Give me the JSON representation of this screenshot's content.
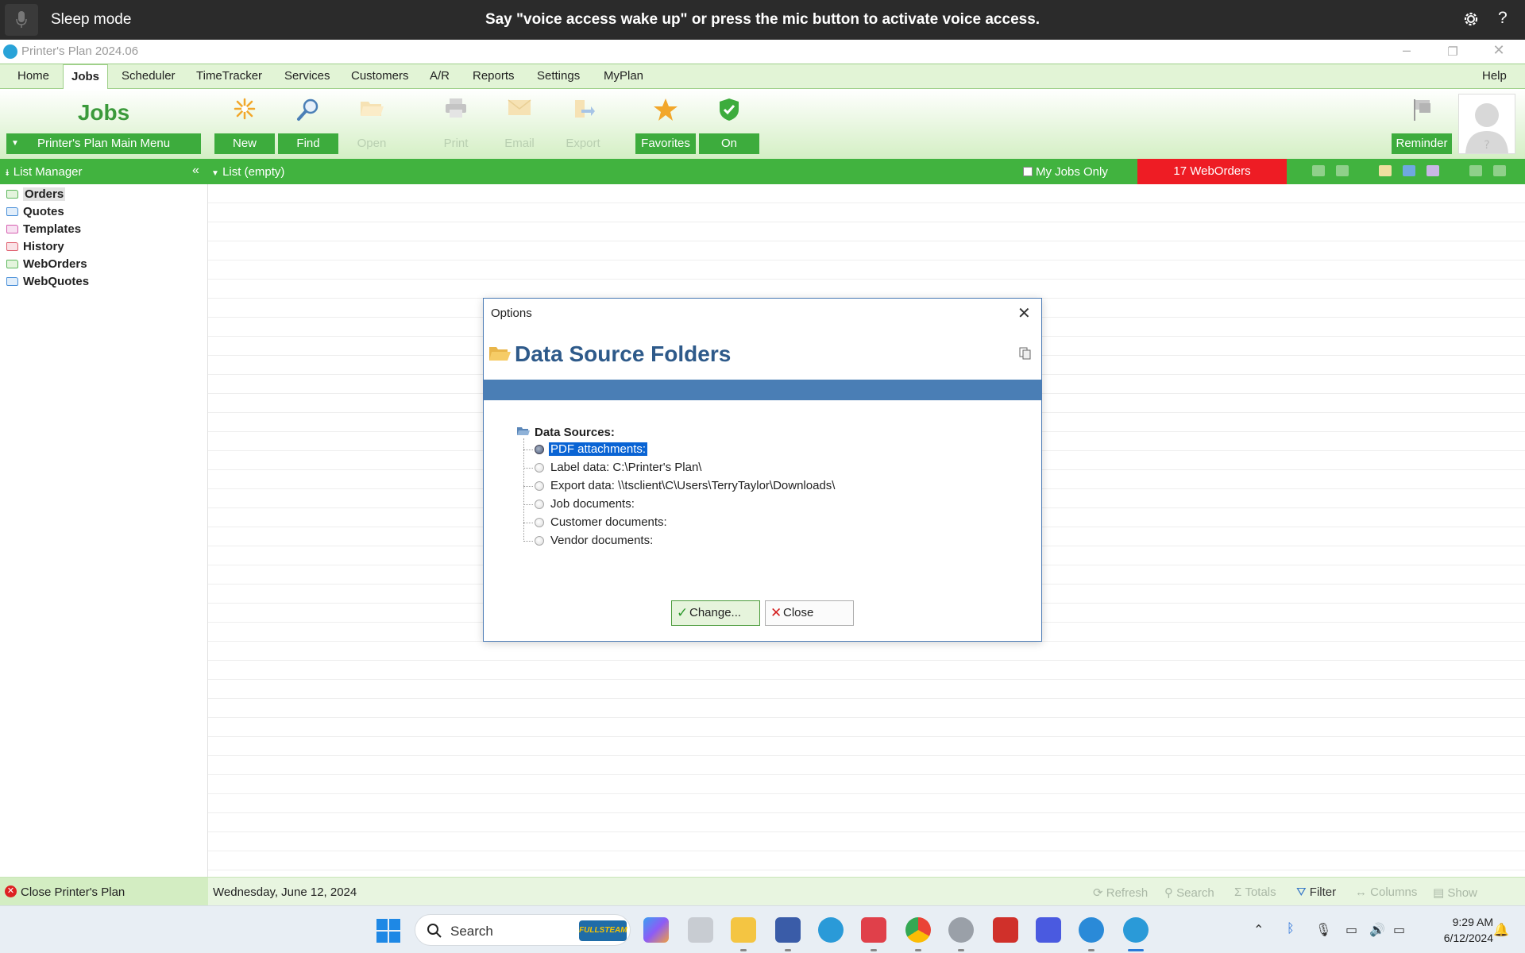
{
  "voice_bar": {
    "status": "Sleep mode",
    "message": "Say \"voice access wake up\" or press the mic button to activate voice access.",
    "help_label": "?"
  },
  "window": {
    "title": "Printer's Plan 2024.06"
  },
  "menu": {
    "tabs": [
      "Home",
      "Jobs",
      "Scheduler",
      "TimeTracker",
      "Services",
      "Customers",
      "A/R",
      "Reports",
      "Settings",
      "MyPlan"
    ],
    "active": "Jobs",
    "help": "Help"
  },
  "ribbon": {
    "section_title": "Jobs",
    "main_menu_label": "Printer's Plan Main Menu",
    "buttons": {
      "new": "New",
      "find": "Find",
      "open": "Open",
      "print": "Print",
      "email": "Email",
      "export": "Export",
      "favorites": "Favorites",
      "on": "On",
      "reminder": "Reminder"
    }
  },
  "list_bar": {
    "list_manager": "List Manager",
    "collapse": "«",
    "list_label": "List (empty)",
    "my_jobs_only": "My Jobs Only",
    "my_jobs_checked": false,
    "weborders": "17 WebOrders",
    "weborders_color": "#ee1c24"
  },
  "sidebar": {
    "folders": [
      {
        "label": "Orders",
        "color": "#5cb85c",
        "selected": true
      },
      {
        "label": "Quotes",
        "color": "#4a90d9",
        "selected": false
      },
      {
        "label": "Templates",
        "color": "#d65fb0",
        "selected": false
      },
      {
        "label": "History",
        "color": "#e06070",
        "selected": false
      },
      {
        "label": "WebOrders",
        "color": "#5cb85c",
        "selected": false
      },
      {
        "label": "WebQuotes",
        "color": "#4a90d9",
        "selected": false
      }
    ]
  },
  "status_bar": {
    "close_app": "Close Printer's Plan",
    "date": "Wednesday, June 12, 2024",
    "actions": {
      "refresh": "Refresh",
      "search": "Search",
      "totals": "Totals",
      "filter": "Filter",
      "columns": "Columns",
      "show": "Show"
    }
  },
  "dialog": {
    "title": "Options",
    "heading": "Data Source Folders",
    "tree_root": "Data Sources:",
    "items": [
      {
        "label": "PDF attachments:",
        "selected": true
      },
      {
        "label": "Label data: C:\\Printer's Plan\\",
        "selected": false
      },
      {
        "label": "Export data: \\\\tsclient\\C\\Users\\TerryTaylor\\Downloads\\",
        "selected": false
      },
      {
        "label": "Job documents:",
        "selected": false
      },
      {
        "label": "Customer documents:",
        "selected": false
      },
      {
        "label": "Vendor documents:",
        "selected": false
      }
    ],
    "change_button": "Change...",
    "close_button": "Close"
  },
  "taskbar": {
    "search_placeholder": "Search",
    "search_badge": "FULLSTEAM",
    "time": "9:29 AM",
    "date": "6/12/2024"
  },
  "colors": {
    "accent_green": "#3dac3d",
    "dialog_blue": "#4a7eb5",
    "selection_blue": "#0a64d4"
  }
}
